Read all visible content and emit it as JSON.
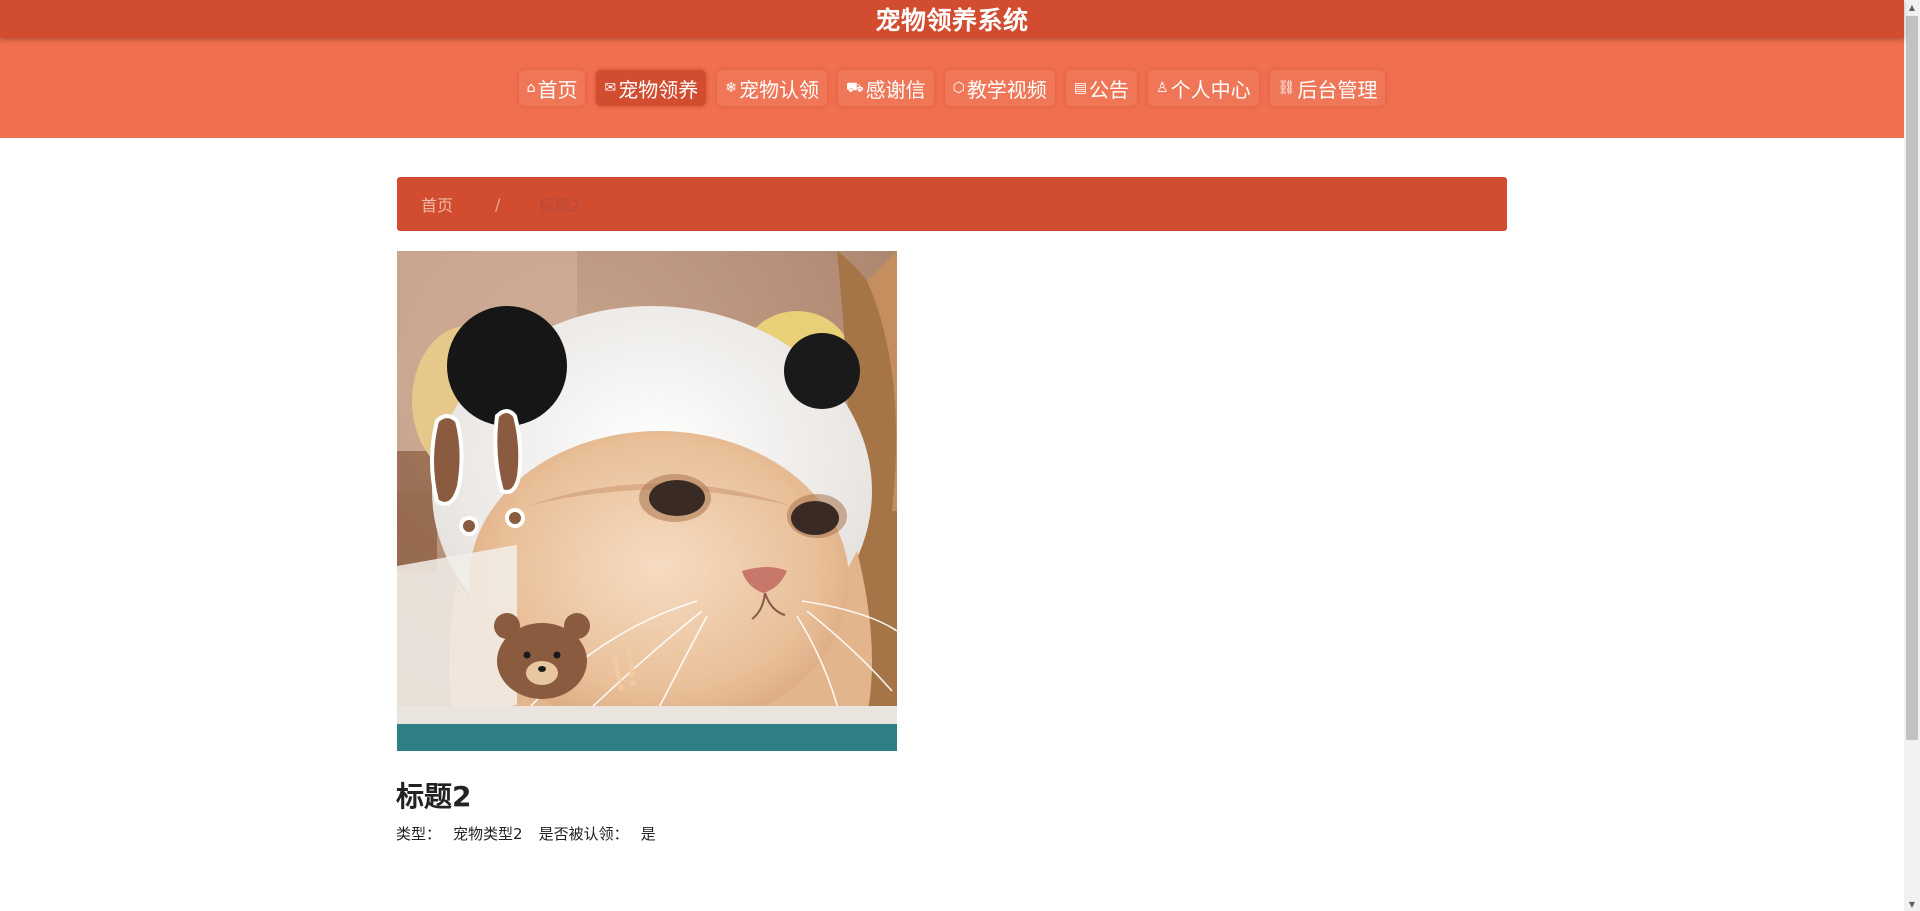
{
  "header": {
    "site_title": "宠物领养系统"
  },
  "nav": {
    "items": [
      {
        "label": "首页",
        "icon": "home-icon",
        "glyph": "⌂",
        "active": false
      },
      {
        "label": "宠物领养",
        "icon": "mail-icon",
        "glyph": "✉",
        "active": true
      },
      {
        "label": "宠物认领",
        "icon": "snowflake-icon",
        "glyph": "❄",
        "active": false
      },
      {
        "label": "感谢信",
        "icon": "book-icon",
        "glyph": "⛟",
        "active": false
      },
      {
        "label": "教学视频",
        "icon": "cube-icon",
        "glyph": "⬡",
        "active": false
      },
      {
        "label": "公告",
        "icon": "clipboard-icon",
        "glyph": "▤",
        "active": false
      },
      {
        "label": "个人中心",
        "icon": "user-icon",
        "glyph": "♙",
        "active": false
      },
      {
        "label": "后台管理",
        "icon": "link-icon",
        "glyph": "⛓",
        "active": false
      }
    ]
  },
  "breadcrumb": {
    "home": "首页",
    "separator": "/",
    "current": "标题2"
  },
  "detail": {
    "image_alt": "cat wearing panda hat",
    "title": "标题2",
    "type_label": "类型：",
    "type_value": "宠物类型2",
    "claimed_label": "是否被认领：",
    "claimed_value": "是"
  },
  "colors": {
    "title_bar": "#d24c30",
    "nav_bar": "#ef6f4e",
    "active_nav": "#d24c30"
  }
}
